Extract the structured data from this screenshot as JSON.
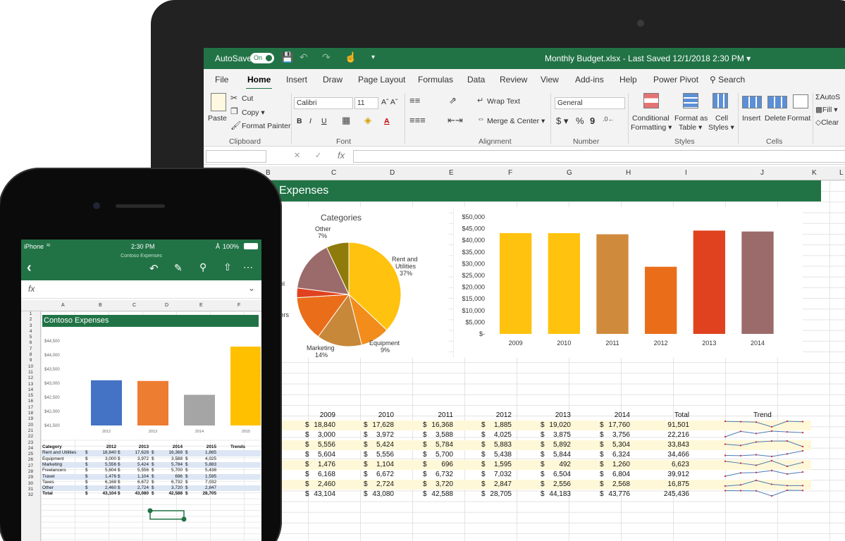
{
  "laptop": {
    "title": {
      "autosave_label": "AutoSave",
      "toggle_label": "On",
      "document": "Monthly Budget.xlsx - Last Saved 12/1/2018 2:30 PM ▾"
    },
    "tabs": [
      "File",
      "Home",
      "Insert",
      "Draw",
      "Page Layout",
      "Formulas",
      "Data",
      "Review",
      "View",
      "Add-ins",
      "Help",
      "Power Pivot"
    ],
    "search_label": "Search",
    "ribbon": {
      "clipboard": {
        "paste": "Paste",
        "cut": "Cut",
        "copy": "Copy ▾",
        "format_painter": "Format Painter",
        "group": "Clipboard"
      },
      "font": {
        "font_name": "Calibri",
        "font_size": "11",
        "bold": "B",
        "italic": "I",
        "underline": "U",
        "group": "Font"
      },
      "alignment": {
        "wrap": "Wrap Text",
        "merge": "Merge & Center ▾",
        "group": "Alignment"
      },
      "number": {
        "format": "General",
        "currency": "$ ▾",
        "percent": "%",
        "comma": "9",
        "group": "Number"
      },
      "styles": {
        "conditional": "Conditional",
        "conditional2": "Formatting ▾",
        "format_as": "Format as",
        "format_as2": "Table ▾",
        "cell": "Cell",
        "cell2": "Styles ▾",
        "group": "Styles"
      },
      "cells": {
        "insert": "Insert",
        "delete": "Delete",
        "format": "Format",
        "group": "Cells"
      },
      "editing": {
        "autosum": "AutoS",
        "fill": "Fill ▾",
        "clear": "Clear"
      }
    },
    "formula_bar": {
      "fx": "fx"
    },
    "columns": [
      "B",
      "C",
      "D",
      "E",
      "F",
      "G",
      "H",
      "I",
      "J",
      "K",
      "L"
    ],
    "banner_title": "Expenses",
    "pie_title": "Categories",
    "pie_labels": {
      "other": "Other",
      "other_pct": "7%",
      "rent": "Rent and",
      "rent2": "Utilities",
      "rent_pct": "37%",
      "equip": "Equipment",
      "equip_pct": "9%",
      "mkt": "Marketing",
      "mkt_pct": "14%",
      "cut1": "el",
      "cut2": "cers"
    },
    "table": {
      "headers": [
        "2009",
        "2010",
        "2011",
        "2012",
        "2013",
        "2014",
        "Total",
        "Trend"
      ],
      "first_label": "es",
      "currency": "$",
      "rows": [
        [
          "18,840",
          "17,628",
          "16,368",
          "1,885",
          "19,020",
          "17,760",
          "91,501"
        ],
        [
          "3,000",
          "3,972",
          "3,588",
          "4,025",
          "3,875",
          "3,756",
          "22,216"
        ],
        [
          "5,556",
          "5,424",
          "5,784",
          "5,883",
          "5,892",
          "5,304",
          "33,843"
        ],
        [
          "5,604",
          "5,556",
          "5,700",
          "5,438",
          "5,844",
          "6,324",
          "34,466"
        ],
        [
          "1,476",
          "1,104",
          "696",
          "1,595",
          "492",
          "1,260",
          "6,623"
        ],
        [
          "6,168",
          "6,672",
          "6,732",
          "7,032",
          "6,504",
          "6,804",
          "39,912"
        ],
        [
          "2,460",
          "2,724",
          "3,720",
          "2,847",
          "2,556",
          "2,568",
          "16,875"
        ],
        [
          "43,104",
          "43,080",
          "42,588",
          "28,705",
          "44,183",
          "43,776",
          "245,436"
        ]
      ]
    }
  },
  "phone": {
    "status": {
      "carrier": "iPhone",
      "time": "2:30 PM",
      "battery": "100%"
    },
    "doc_title": "Contoso Expenses",
    "fx": "fx",
    "columns": [
      "A",
      "B",
      "C",
      "D",
      "E",
      "F"
    ],
    "row_numbers": [
      "1",
      "2",
      "3",
      "4",
      "5",
      "6",
      "7",
      "8",
      "9",
      "10",
      "11",
      "12",
      "13",
      "14",
      "15",
      "16",
      "17",
      "18",
      "19",
      "20",
      "21",
      "22",
      "23",
      "24",
      "25",
      "26",
      "27",
      "28",
      "29",
      "30",
      "31",
      "32"
    ],
    "banner_title": "Contoso Expenses",
    "table": {
      "headers": [
        "Category",
        "2012",
        "2013",
        "2014",
        "2015",
        "Trends"
      ],
      "currency": "$",
      "rows": [
        [
          "Rent and Utilities",
          "18,840",
          "17,628",
          "16,368",
          "1,885"
        ],
        [
          "Equipment",
          "3,000",
          "3,972",
          "3,588",
          "4,025"
        ],
        [
          "Marketing",
          "5,556",
          "5,424",
          "5,784",
          "5,883"
        ],
        [
          "Freelancers",
          "5,604",
          "5,556",
          "5,700",
          "5,438"
        ],
        [
          "Travel",
          "1,476",
          "1,104",
          "696",
          "1,595"
        ],
        [
          "Taxes",
          "6,168",
          "6,672",
          "6,732",
          "7,032"
        ],
        [
          "Other",
          "2,460",
          "2,724",
          "3,720",
          "2,847"
        ],
        [
          "Total",
          "43,104",
          "43,080",
          "42,588",
          "28,705"
        ]
      ]
    }
  },
  "chart_data": [
    {
      "type": "pie",
      "title": "Categories",
      "categories": [
        "Rent and Utilities",
        "Equipment",
        "Marketing",
        "Freelancers",
        "Travel",
        "Taxes",
        "Other"
      ],
      "values": [
        37,
        9,
        14,
        14,
        3,
        16,
        7
      ],
      "colors": [
        "#ffc20e",
        "#f28c1b",
        "#c8883a",
        "#ea6e1a",
        "#e0421f",
        "#9b6a6a",
        "#8f7a0c"
      ]
    },
    {
      "type": "bar",
      "categories": [
        "2009",
        "2010",
        "2011",
        "2012",
        "2013",
        "2014"
      ],
      "values": [
        43104,
        43080,
        42588,
        28705,
        44183,
        43776
      ],
      "colors": [
        "#ffc20e",
        "#ffc20e",
        "#d08a3c",
        "#ea6e1a",
        "#e0421f",
        "#9b6a6a"
      ],
      "ylim": [
        0,
        50000
      ],
      "yticks": [
        "$-",
        "$5,000",
        "$10,000",
        "$15,000",
        "$20,000",
        "$25,000",
        "$30,000",
        "$35,000",
        "$40,000",
        "$45,000",
        "$50,000"
      ]
    },
    {
      "type": "bar",
      "categories": [
        "2012",
        "2013",
        "2014",
        "2015"
      ],
      "values": [
        43104,
        43080,
        42588,
        44300
      ],
      "colors": [
        "#4472c4",
        "#ed7d31",
        "#a5a5a5",
        "#ffc000"
      ],
      "ylim": [
        41500,
        44500
      ],
      "yticks": [
        "$41,500",
        "$42,000",
        "$42,500",
        "$43,000",
        "$43,500",
        "$44,000",
        "$44,500"
      ]
    }
  ]
}
